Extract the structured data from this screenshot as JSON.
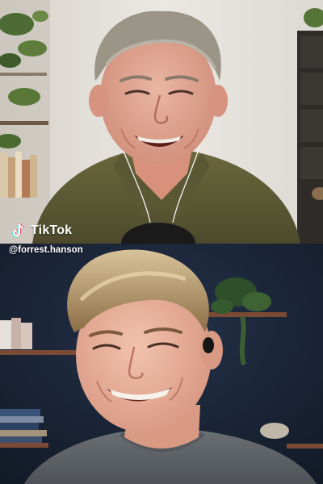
{
  "video": {
    "layout": "split-screen stitch",
    "top_panel": {
      "subject": "older man smiling, olive green shirt, wired earbuds",
      "background": "light wall with plants and shelves"
    },
    "bottom_panel": {
      "subject": "younger man grinning, grey t-shirt, in-ear earbud",
      "background": "dark navy wall with shelves, books and plants"
    }
  },
  "watermark": {
    "brand": "TikTok",
    "handle": "@forrest.hanson",
    "logo_icon": "tiktok-note-icon"
  },
  "colors": {
    "top_bg": "#e7e4de",
    "bottom_bg": "#1b2536",
    "shirt_top": "#5d5a33",
    "shirt_bottom": "#5e6367",
    "skin_top": "#e2a995",
    "skin_bottom": "#e9b49e"
  }
}
